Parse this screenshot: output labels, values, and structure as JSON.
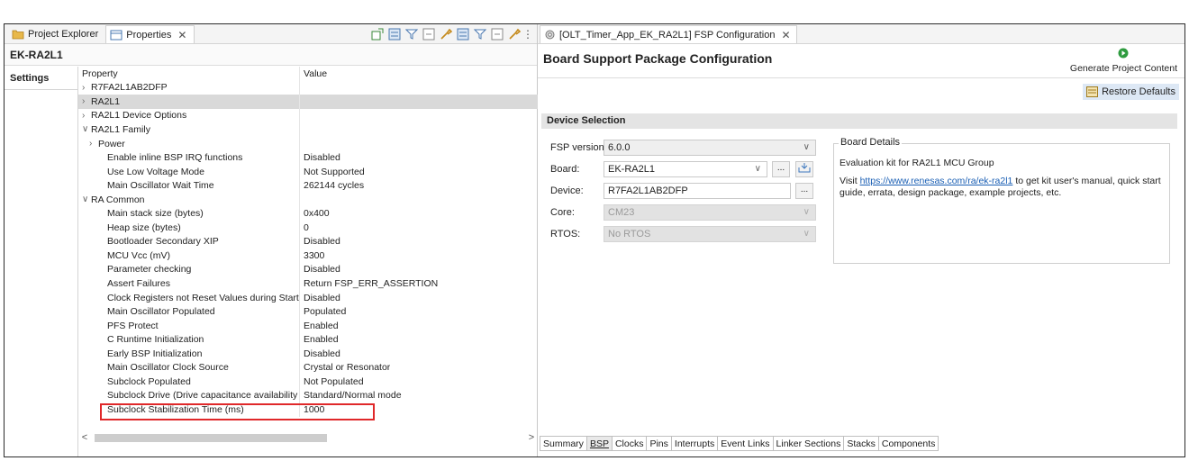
{
  "left_tabs": [
    {
      "label": "Project Explorer"
    },
    {
      "label": "Properties"
    }
  ],
  "left_tab_close": "✕",
  "left_title": "EK-RA2L1",
  "settings_label": "Settings",
  "grid_header": {
    "property": "Property",
    "value": "Value"
  },
  "rows": [
    {
      "label": "R7FA2L1AB2DFP",
      "value": "",
      "level": 1,
      "expander": "›"
    },
    {
      "label": "RA2L1",
      "value": "",
      "level": 1,
      "expander": "›"
    },
    {
      "label": "RA2L1 Device Options",
      "value": "",
      "level": 1,
      "expander": "›"
    },
    {
      "label": "RA2L1 Family",
      "value": "",
      "level": 1,
      "expander": "∨"
    },
    {
      "label": "Power",
      "value": "",
      "level": 2,
      "expander": "›"
    },
    {
      "label": "Enable inline BSP IRQ functions",
      "value": "Disabled",
      "level": 3
    },
    {
      "label": "Use Low Voltage Mode",
      "value": "Not Supported",
      "level": 3
    },
    {
      "label": "Main Oscillator Wait Time",
      "value": "262144 cycles",
      "level": 3
    },
    {
      "label": "RA Common",
      "value": "",
      "level": 1,
      "expander": "∨"
    },
    {
      "label": "Main stack size (bytes)",
      "value": "0x400",
      "level": 3
    },
    {
      "label": "Heap size (bytes)",
      "value": "0",
      "level": 3
    },
    {
      "label": "Bootloader Secondary XIP",
      "value": "Disabled",
      "level": 3
    },
    {
      "label": "MCU Vcc (mV)",
      "value": "3300",
      "level": 3
    },
    {
      "label": "Parameter checking",
      "value": "Disabled",
      "level": 3
    },
    {
      "label": "Assert Failures",
      "value": "Return FSP_ERR_ASSERTION",
      "level": 3
    },
    {
      "label": "Clock Registers not Reset Values during Startup",
      "value": "Disabled",
      "level": 3
    },
    {
      "label": "Main Oscillator Populated",
      "value": "Populated",
      "level": 3
    },
    {
      "label": "PFS Protect",
      "value": "Enabled",
      "level": 3
    },
    {
      "label": "C Runtime Initialization",
      "value": "Enabled",
      "level": 3
    },
    {
      "label": "Early BSP Initialization",
      "value": "Disabled",
      "level": 3
    },
    {
      "label": "Main Oscillator Clock Source",
      "value": "Crystal or Resonator",
      "level": 3
    },
    {
      "label": "Subclock Populated",
      "value": "Not Populated",
      "level": 3
    },
    {
      "label": "Subclock Drive (Drive capacitance availability va",
      "value": "Standard/Normal mode",
      "level": 3
    },
    {
      "label": "Subclock Stabilization Time (ms)",
      "value": "1000",
      "level": 3
    }
  ],
  "scroll": {
    "left": "<",
    "right": ">"
  },
  "editor_tab": {
    "label": "[OLT_Timer_App_EK_RA2L1] FSP Configuration",
    "close": "✕"
  },
  "bsp_title": "Board Support Package Configuration",
  "generate_label": "Generate Project Content",
  "restore_label": "Restore Defaults",
  "device_selection": "Device Selection",
  "fsp_version": {
    "label": "FSP version:",
    "value": "6.0.0"
  },
  "board": {
    "label": "Board:",
    "value": "EK-RA2L1",
    "browse": "..."
  },
  "device": {
    "label": "Device:",
    "value": "R7FA2L1AB2DFP",
    "browse": "..."
  },
  "core": {
    "label": "Core:",
    "value": "CM23"
  },
  "rtos": {
    "label": "RTOS:",
    "value": "No RTOS"
  },
  "details": {
    "legend": "Board Details",
    "line1": "Evaluation kit for RA2L1 MCU Group",
    "visit": "Visit ",
    "link": "https://www.renesas.com/ra/ek-ra2l1",
    "after": " to get kit user's manual, quick start guide, errata, design package, example projects, etc."
  },
  "bottom_tabs": [
    "Summary",
    "BSP",
    "Clocks",
    "Pins",
    "Interrupts",
    "Event Links",
    "Linker Sections",
    "Stacks",
    "Components"
  ],
  "active_bottom_tab": "BSP",
  "colors": {
    "highlight_box": "#e0282a",
    "link": "#1a5fb4",
    "selected_row": "#d9d9d9"
  }
}
